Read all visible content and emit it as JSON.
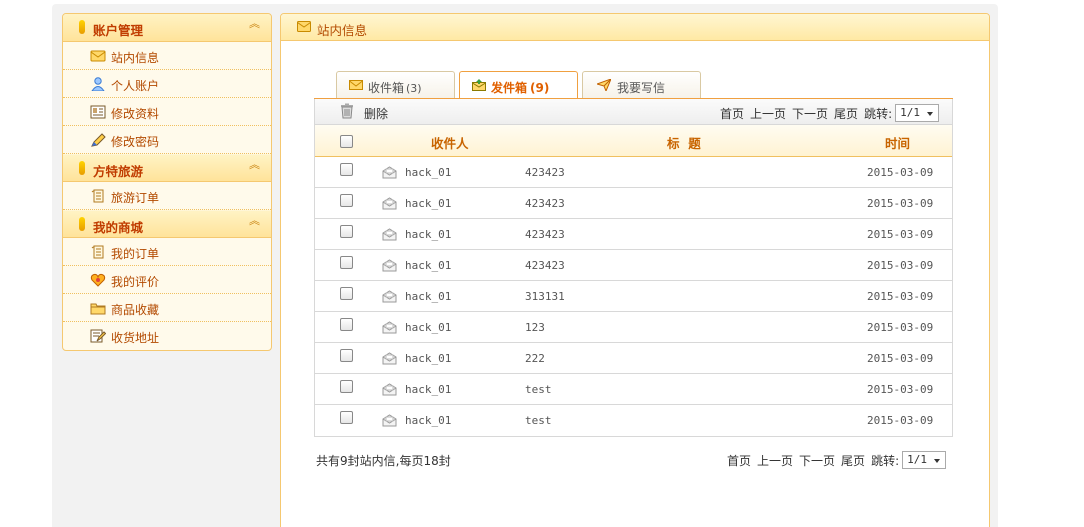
{
  "sidebar": {
    "groups": [
      {
        "title": "账户管理",
        "items": [
          {
            "label": "站内信息",
            "icon": "message-icon"
          },
          {
            "label": "个人账户",
            "icon": "user-icon"
          },
          {
            "label": "修改资料",
            "icon": "profile-card-icon"
          },
          {
            "label": "修改密码",
            "icon": "pencil-icon"
          }
        ]
      },
      {
        "title": "方特旅游",
        "items": [
          {
            "label": "旅游订单",
            "icon": "order-scroll-icon"
          }
        ]
      },
      {
        "title": "我的商城",
        "items": [
          {
            "label": "我的订单",
            "icon": "order-scroll-icon"
          },
          {
            "label": "我的评价",
            "icon": "heart-icon"
          },
          {
            "label": "商品收藏",
            "icon": "folder-icon"
          },
          {
            "label": "收货地址",
            "icon": "address-edit-icon"
          }
        ]
      }
    ],
    "collapse_glyph": "︽"
  },
  "main": {
    "title": "站内信息",
    "tabs": [
      {
        "label": "收件箱",
        "count": "(3)",
        "active": false
      },
      {
        "label": "发件箱",
        "count": "(9)",
        "active": true
      },
      {
        "label": "我要写信",
        "count": "",
        "active": false
      }
    ],
    "toolbar": {
      "delete_label": "删除"
    },
    "pager": {
      "first": "首页",
      "prev": "上一页",
      "next": "下一页",
      "last": "尾页",
      "jump": "跳转:",
      "current": "1/1"
    },
    "table": {
      "headers": {
        "recipient": "收件人",
        "subject": "标  题",
        "time": "时间"
      },
      "rows": [
        {
          "recipient": "hack_01",
          "subject": "423423",
          "time": "2015-03-09"
        },
        {
          "recipient": "hack_01",
          "subject": "423423",
          "time": "2015-03-09"
        },
        {
          "recipient": "hack_01",
          "subject": "423423",
          "time": "2015-03-09"
        },
        {
          "recipient": "hack_01",
          "subject": "423423",
          "time": "2015-03-09"
        },
        {
          "recipient": "hack_01",
          "subject": "313131",
          "time": "2015-03-09"
        },
        {
          "recipient": "hack_01",
          "subject": "123",
          "time": "2015-03-09"
        },
        {
          "recipient": "hack_01",
          "subject": "222",
          "time": "2015-03-09"
        },
        {
          "recipient": "hack_01",
          "subject": "test",
          "time": "2015-03-09"
        },
        {
          "recipient": "hack_01",
          "subject": "test",
          "time": "2015-03-09"
        }
      ]
    },
    "summary": "共有9封站内信,每页18封"
  },
  "colors": {
    "accent": "#e06000",
    "link": "#b34a00",
    "border": "#f5c870",
    "header_bg": "#ffe9a4"
  }
}
